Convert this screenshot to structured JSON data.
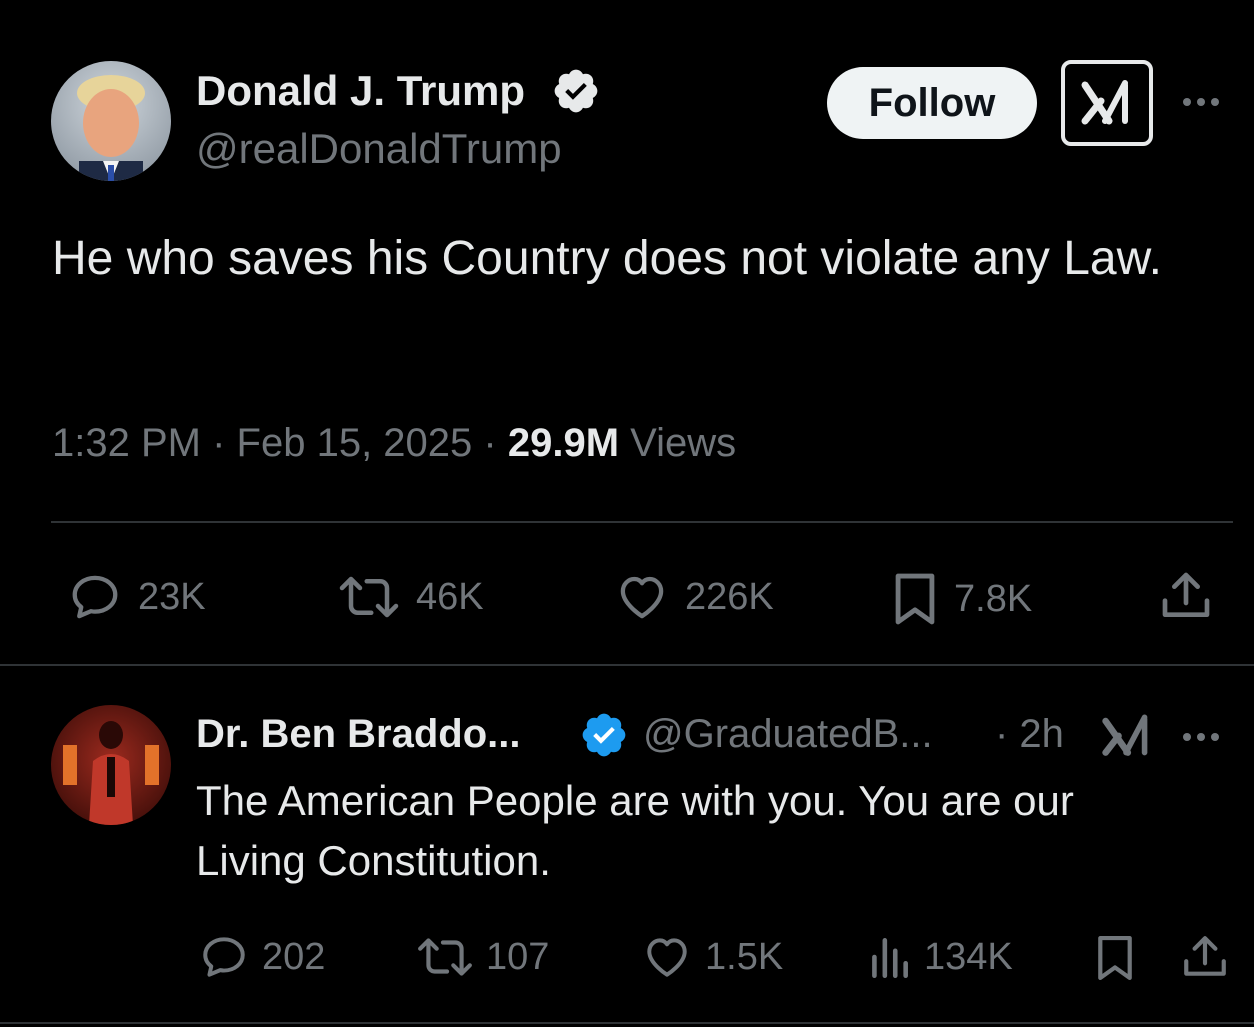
{
  "tweet": {
    "author_name": "Donald J. Trump",
    "author_handle": "@realDonaldTrump",
    "follow_label": "Follow",
    "text": "He who saves his Country does not violate any Law.",
    "time": "1:32 PM",
    "date": "Feb 15, 2025",
    "views_count": "29.9M",
    "views_label": "Views",
    "separator": "·",
    "stats": {
      "replies": "23K",
      "reposts": "46K",
      "likes": "226K",
      "bookmarks": "7.8K"
    }
  },
  "reply": {
    "author_name": "Dr. Ben Braddo...",
    "author_handle": "@GraduatedB...",
    "age": "· 2h",
    "text": "The American People are with you. You are our Living Constitution.",
    "stats": {
      "replies": "202",
      "reposts": "107",
      "likes": "1.5K",
      "views": "134K"
    }
  },
  "colors": {
    "background": "#000000",
    "text": "#e7e9ea",
    "muted": "#71767b",
    "verified_gold": "#e7e9ea",
    "verified_blue": "#1d9bf0",
    "divider": "#2f3336"
  },
  "icons": [
    "verified-badge-icon",
    "grok-icon",
    "more-icon",
    "reply-icon",
    "repost-icon",
    "like-icon",
    "bookmark-icon",
    "share-icon",
    "views-icon"
  ]
}
